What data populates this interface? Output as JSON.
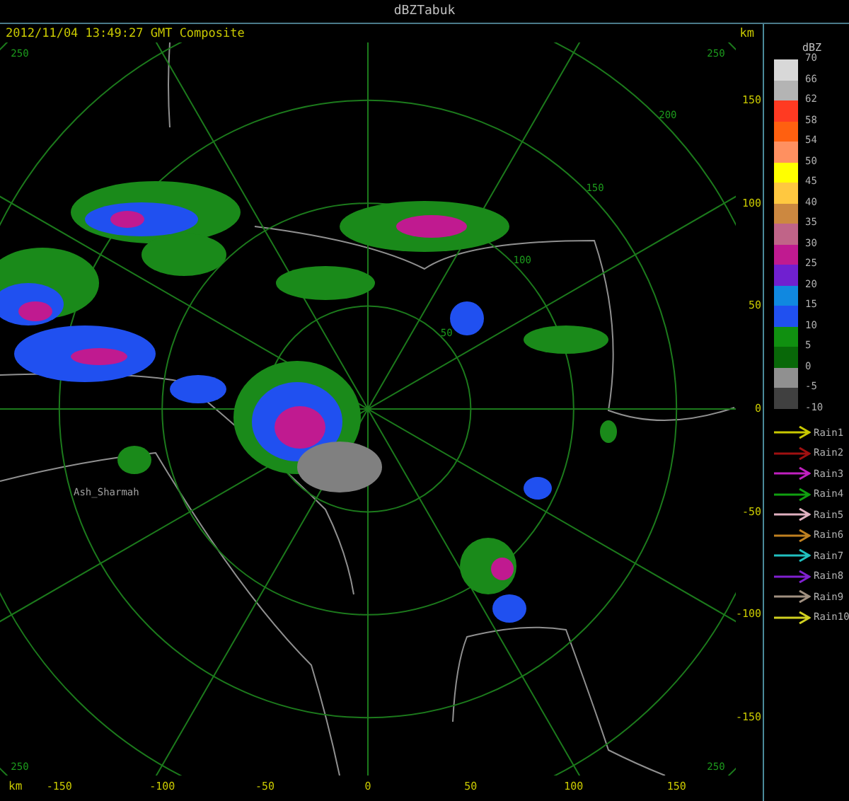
{
  "window": {
    "title": "dBZTabuk"
  },
  "header": {
    "timestamp": "2012/11/04 13:49:27 GMT Composite",
    "unit": "km"
  },
  "map": {
    "ring_labels": [
      "50",
      "100",
      "150",
      "200"
    ],
    "corner_labels": [
      "250",
      "250",
      "250",
      "250"
    ],
    "place_labels": [
      "Ash_Sharmah"
    ]
  },
  "y_axis": {
    "ticks": [
      "150",
      "100",
      "50",
      "0",
      "-50",
      "-100",
      "-150"
    ]
  },
  "x_axis": {
    "unit": "km",
    "ticks": [
      "-150",
      "-100",
      "-50",
      "0",
      "50",
      "100",
      "150"
    ]
  },
  "legend": {
    "unit": "dBZ",
    "scale": [
      {
        "label": "70",
        "color": "#d8d8d8"
      },
      {
        "label": "66",
        "color": "#b4b4b4"
      },
      {
        "label": "62",
        "color": "#ff3a22"
      },
      {
        "label": "58",
        "color": "#ff6010"
      },
      {
        "label": "54",
        "color": "#ff9060"
      },
      {
        "label": "50",
        "color": "#ffff00"
      },
      {
        "label": "45",
        "color": "#ffc840"
      },
      {
        "label": "40",
        "color": "#cc8840"
      },
      {
        "label": "35",
        "color": "#c06488"
      },
      {
        "label": "30",
        "color": "#c01a90"
      },
      {
        "label": "25",
        "color": "#7020d0"
      },
      {
        "label": "20",
        "color": "#1088e0"
      },
      {
        "label": "15",
        "color": "#2050f0"
      },
      {
        "label": "10",
        "color": "#109010"
      },
      {
        "label": "5",
        "color": "#086808"
      },
      {
        "label": "0",
        "color": "#909090"
      },
      {
        "label": "-5",
        "color": "#404040"
      }
    ],
    "extra_label": "-10",
    "tracks": [
      {
        "label": "Rain1",
        "color": "#c8c800"
      },
      {
        "label": "Rain2",
        "color": "#a01010"
      },
      {
        "label": "Rain3",
        "color": "#c020c0"
      },
      {
        "label": "Rain4",
        "color": "#10a010"
      },
      {
        "label": "Rain5",
        "color": "#e0b0c0"
      },
      {
        "label": "Rain6",
        "color": "#c08020"
      },
      {
        "label": "Rain7",
        "color": "#20c0c0"
      },
      {
        "label": "Rain8",
        "color": "#8020d0"
      },
      {
        "label": "Rain9",
        "color": "#a09080"
      },
      {
        "label": "Rain10",
        "color": "#d0d020"
      }
    ]
  }
}
